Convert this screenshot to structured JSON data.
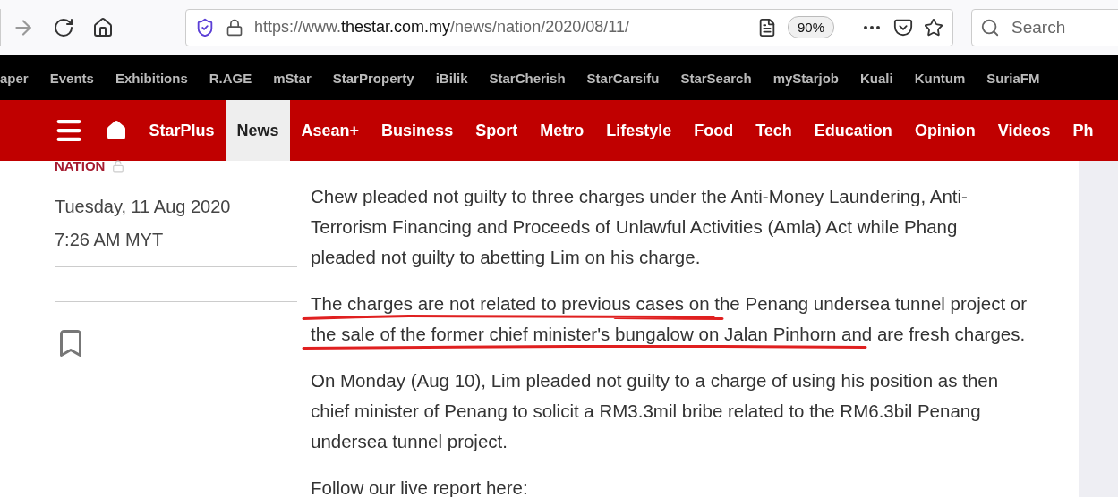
{
  "browser": {
    "url": {
      "scheme": "https://www.",
      "domain": "thestar.com.my",
      "path": "/news/nation/2020/08/11/"
    },
    "zoom": "90%",
    "search_placeholder": "Search"
  },
  "top_links": [
    "aper",
    "Events",
    "Exhibitions",
    "R.AGE",
    "mStar",
    "StarProperty",
    "iBilik",
    "StarCherish",
    "StarCarsifu",
    "StarSearch",
    "myStarjob",
    "Kuali",
    "Kuntum",
    "SuriaFM"
  ],
  "nav": [
    {
      "label": "StarPlus",
      "selected": false
    },
    {
      "label": "News",
      "selected": true
    },
    {
      "label": "Asean+",
      "selected": false
    },
    {
      "label": "Business",
      "selected": false
    },
    {
      "label": "Sport",
      "selected": false
    },
    {
      "label": "Metro",
      "selected": false
    },
    {
      "label": "Lifestyle",
      "selected": false
    },
    {
      "label": "Food",
      "selected": false
    },
    {
      "label": "Tech",
      "selected": false
    },
    {
      "label": "Education",
      "selected": false
    },
    {
      "label": "Opinion",
      "selected": false
    },
    {
      "label": "Videos",
      "selected": false
    },
    {
      "label": "Ph",
      "selected": false
    }
  ],
  "article": {
    "section": "NATION",
    "date": "Tuesday, 11 Aug 2020",
    "time": "7:26 AM MYT",
    "paragraphs": [
      {
        "underlined": false,
        "lines": [
          "Chew pleaded not guilty to three charges under the Anti-Money Laundering, Anti-",
          "Terrorism Financing and Proceeds of Unlawful Activities (Amla) Act while Phang",
          "pleaded not guilty to abetting Lim on his charge."
        ]
      },
      {
        "underlined": true,
        "lines": [
          "The charges are not related to previous cases on the Penang undersea tunnel project or",
          "the sale of the former chief minister's bungalow on Jalan Pinhorn and are fresh charges."
        ]
      },
      {
        "underlined": false,
        "lines": [
          "On Monday (Aug 10), Lim pleaded not guilty to a charge of using his position as then",
          "chief minister of Penang to solicit a RM3.3mil bribe related to the RM6.3bil Penang",
          "undersea tunnel project."
        ]
      },
      {
        "lines": [
          "Follow our live report here:"
        ]
      }
    ]
  }
}
